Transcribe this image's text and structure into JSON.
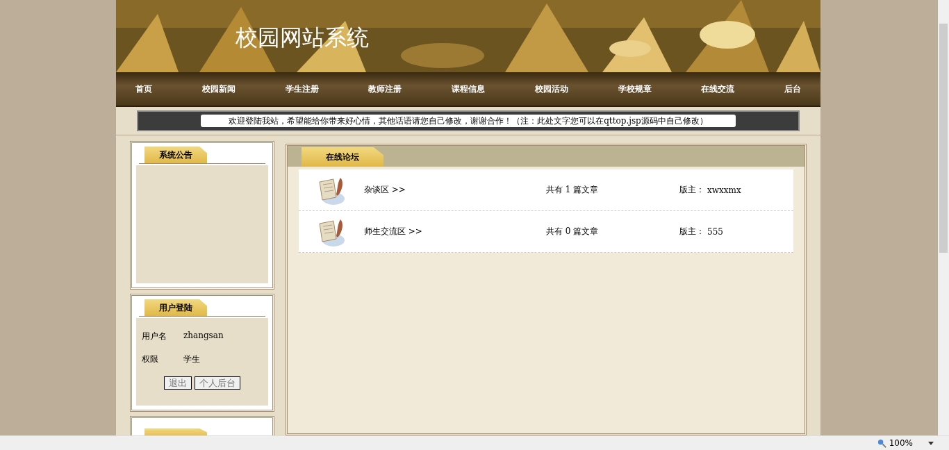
{
  "header": {
    "title": "校园网站系统"
  },
  "nav": [
    "首页",
    "校园新闻",
    "学生注册",
    "教师注册",
    "课程信息",
    "校园活动",
    "学校规章",
    "在线交流",
    "后台"
  ],
  "marquee": "欢迎登陆我站，希望能给你带来好心情，其他话语请您自己修改，谢谢合作！（注：此处文字您可以在qttop.jsp源码中自己修改）",
  "notice_panel": {
    "title": "系统公告"
  },
  "login_panel": {
    "title": "用户登陆",
    "fields": [
      {
        "label": "用户名",
        "value": "zhangsan"
      },
      {
        "label": "权限",
        "value": "学生"
      }
    ],
    "buttons": [
      "退出",
      "个人后台"
    ]
  },
  "forum": {
    "title": "在线论坛",
    "boards": [
      {
        "name": "杂谈区 >>",
        "count": "共有 1 篇文章",
        "moderator_label": "版主：",
        "moderator": "xwxxmx"
      },
      {
        "name": "师生交流区 >>",
        "count": "共有 0 篇文章",
        "moderator_label": "版主：",
        "moderator": "555"
      }
    ]
  },
  "status_bar": {
    "zoom": "100%"
  }
}
